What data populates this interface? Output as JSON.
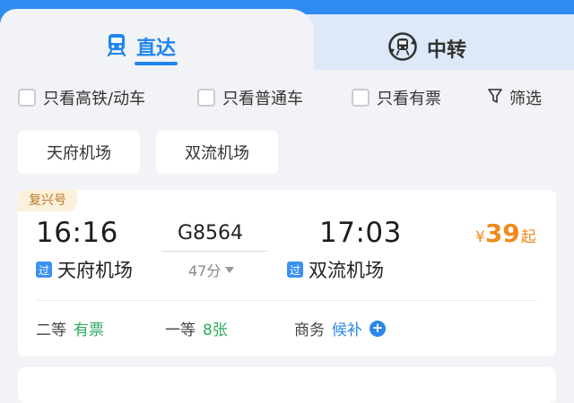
{
  "tabs": {
    "direct": {
      "label": "直达",
      "icon": "train-icon",
      "active": true
    },
    "transfer": {
      "label": "中转",
      "icon": "transfer-train-icon",
      "active": false
    }
  },
  "filters": {
    "high_speed": {
      "label": "只看高铁/动车",
      "checked": false
    },
    "normal": {
      "label": "只看普通车",
      "checked": false
    },
    "available": {
      "label": "只看有票",
      "checked": false
    },
    "filter_button": {
      "label": "筛选",
      "icon": "filter-icon"
    }
  },
  "stations": [
    {
      "label": "天府机场"
    },
    {
      "label": "双流机场"
    }
  ],
  "train": {
    "type": "复兴号",
    "dep_time": "16:16",
    "arr_time": "17:03",
    "number": "G8564",
    "duration": "47分",
    "dep_station": "天府机场",
    "arr_station": "双流机场",
    "pass_badge": "过",
    "price_symbol": "¥",
    "price": "39",
    "price_suffix": "起",
    "seats": [
      {
        "class": "二等",
        "status": "有票"
      },
      {
        "class": "一等",
        "status": "8张"
      },
      {
        "class": "商务",
        "status": "候补"
      }
    ]
  },
  "colors": {
    "accent": "#1f86ee",
    "price": "#f08a1c",
    "available": "#2eab5c",
    "waitlist": "#2b86e8",
    "type_badge_bg": "#fdf0da"
  }
}
